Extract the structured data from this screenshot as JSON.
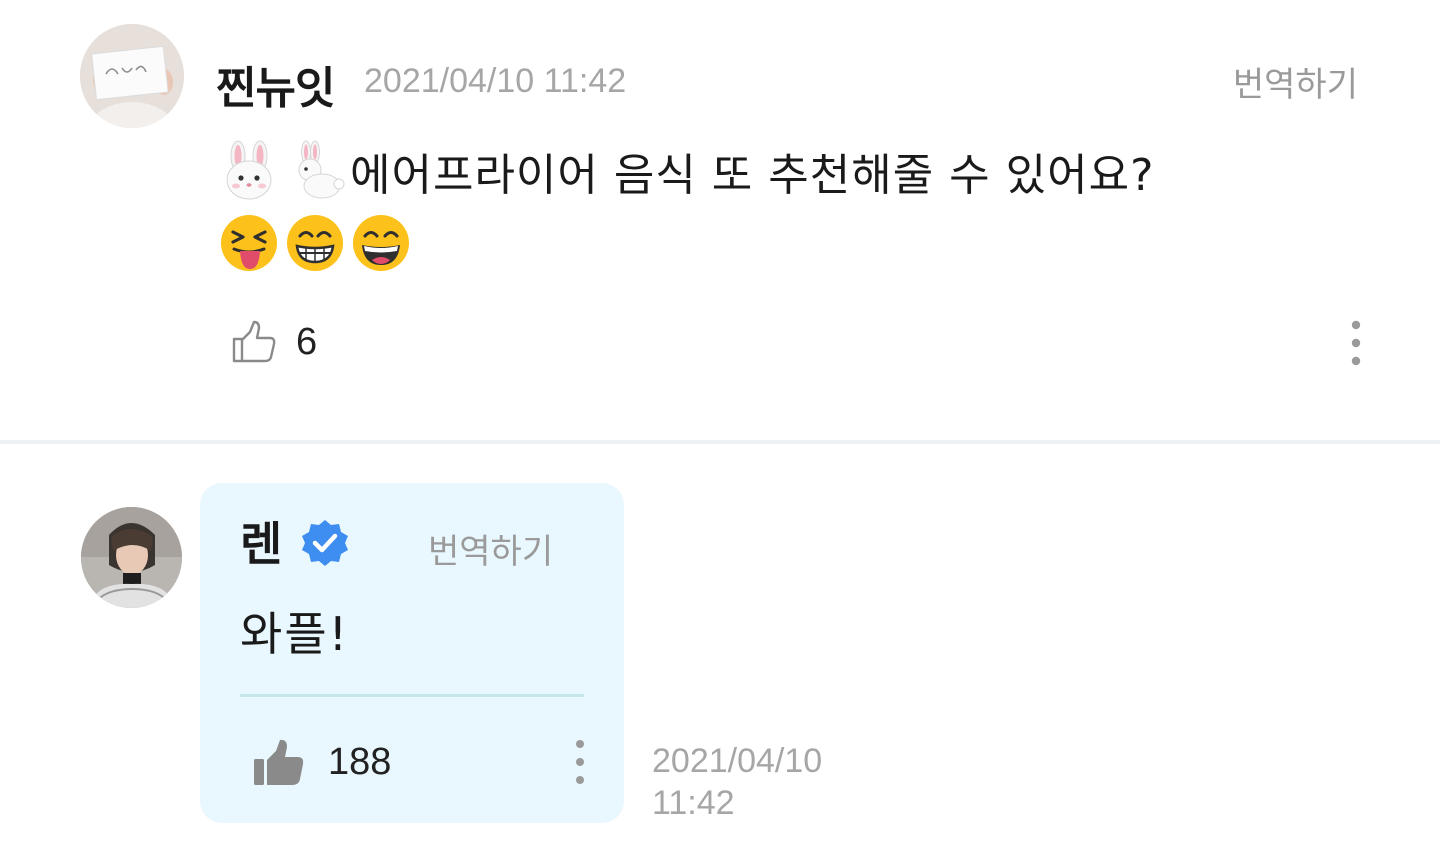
{
  "post": {
    "author": "찐뉴잇",
    "timestamp": "2021/04/10 11:42",
    "translate_label": "번역하기",
    "text": "에어프라이어 음식 또 추천해줄 수 있어요?",
    "leading_emojis": [
      "rabbit-face-emoji",
      "rabbit-emoji"
    ],
    "trailing_emojis": [
      "squinting-tongue-emoji",
      "grimacing-grin-emoji",
      "grinning-face-emoji"
    ],
    "likes": "6"
  },
  "reply": {
    "author": "렌",
    "verified": true,
    "translate_label": "번역하기",
    "text": "와플!",
    "likes": "188",
    "timestamp_date": "2021/04/10",
    "timestamp_time": "11:42"
  },
  "colors": {
    "bubble_background": "#e9f7fe",
    "verified_badge": "#3d8ef0",
    "muted_text": "#a6a6a6"
  }
}
